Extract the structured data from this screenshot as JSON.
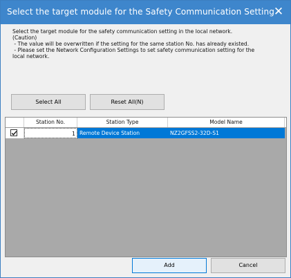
{
  "dialog": {
    "title": "Select the target module for the Safety Communication Setting",
    "close_glyph": "✕"
  },
  "description": {
    "line1": "Select the target module for the safety communication setting in the local network.",
    "line2": "(Caution)",
    "line3": " - The value will be overwritten if the setting for the same station No. has already existed.",
    "line4": " - Please set the Network Configuration Settings to set safety communication setting for the",
    "line5": "local network."
  },
  "toolbar": {
    "select_all_label": "Select All",
    "reset_all_label": "Reset All(N)"
  },
  "table": {
    "columns": [
      "",
      "Station No.",
      "Station Type",
      "Model Name"
    ],
    "rows": [
      {
        "checked": true,
        "station_no": "1",
        "station_type": "Remote Device Station",
        "model_name": "NZ2GFSS2-32D-S1"
      }
    ]
  },
  "footer": {
    "add_label": "Add",
    "cancel_label": "Cancel"
  },
  "colors": {
    "titlebar": "#3e86cc",
    "selection": "#0078d7",
    "grid_background": "#a9a9a9"
  },
  "icons": {
    "close": "close-icon",
    "checkbox": "checkmark-icon"
  }
}
